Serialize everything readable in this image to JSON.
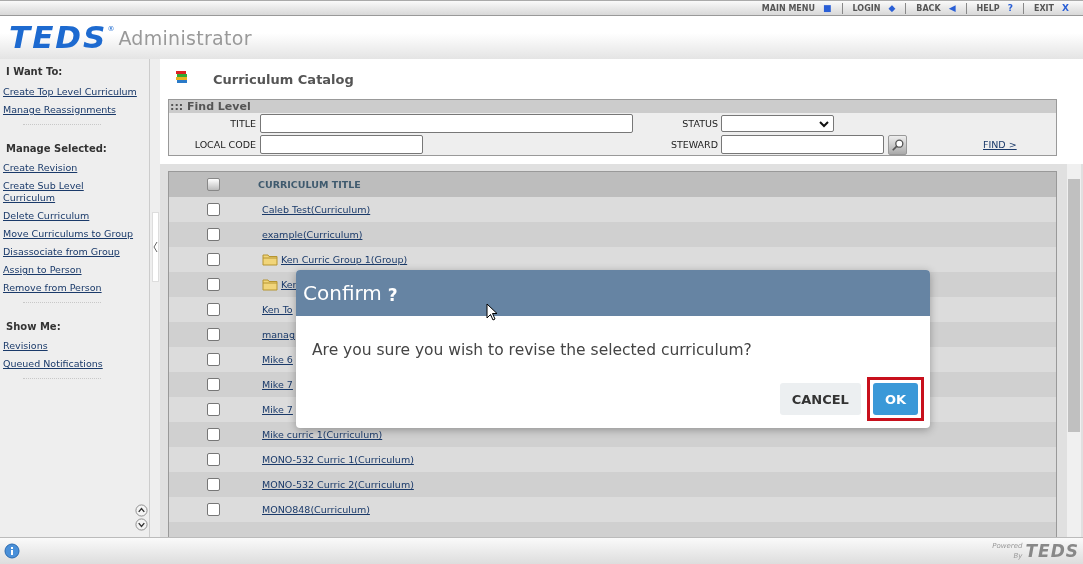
{
  "top_nav": [
    {
      "label": "MAIN MENU",
      "icon": "■"
    },
    {
      "label": "LOGIN",
      "icon": "◆"
    },
    {
      "label": "BACK",
      "icon": "◀"
    },
    {
      "label": "HELP",
      "icon": "?"
    },
    {
      "label": "EXIT",
      "icon": "X"
    }
  ],
  "header": {
    "logo": "TEDS",
    "logo_mark": "®",
    "title": "Administrator"
  },
  "sidebar": {
    "sections": [
      {
        "heading": "I Want To:",
        "links": [
          "Create Top Level Curriculum",
          "Manage Reassignments"
        ]
      },
      {
        "heading": "Manage Selected:",
        "links": [
          "Create Revision",
          "Create Sub Level\nCurriculum",
          "Delete Curriculum",
          "Move Curriculums to Group",
          "Disassociate from Group",
          "Assign to Person",
          "Remove from Person"
        ]
      },
      {
        "heading": "Show Me:",
        "links": [
          "Revisions",
          "Queued Notifications"
        ]
      }
    ]
  },
  "page_title": "Curriculum Catalog",
  "find_panel": {
    "title": "::: Find Level",
    "rows": [
      [
        {
          "label": "TITLE",
          "kind": "text"
        },
        {
          "label": "STATUS",
          "kind": "select"
        }
      ],
      [
        {
          "label": "LOCAL CODE",
          "kind": "text"
        },
        {
          "label": "STEWARD",
          "kind": "lookup"
        }
      ]
    ],
    "find_link": "FIND >"
  },
  "table": {
    "header": "CURRICULUM TITLE",
    "header_checked": false,
    "rows": [
      {
        "title": "Caleb Test(Curriculum)",
        "kind": "curriculum",
        "checked": false
      },
      {
        "title": "example(Curriculum)",
        "kind": "curriculum",
        "checked": false
      },
      {
        "title": "Ken Curric Group 1(Group)",
        "kind": "group",
        "checked": false
      },
      {
        "title": "Ken",
        "kind": "group",
        "checked": false
      },
      {
        "title": "Ken To",
        "kind": "curriculum",
        "checked": false
      },
      {
        "title": "manag",
        "kind": "curriculum",
        "checked": false
      },
      {
        "title": "Mike 6",
        "kind": "curriculum",
        "checked": false
      },
      {
        "title": "Mike 7",
        "kind": "curriculum",
        "checked": false
      },
      {
        "title": "Mike 7",
        "kind": "curriculum",
        "checked": false
      },
      {
        "title": "Mike curric 1(Curriculum)",
        "kind": "curriculum",
        "checked": false
      },
      {
        "title": "MONO-532 Curric 1(Curriculum)",
        "kind": "curriculum",
        "checked": false
      },
      {
        "title": "MONO-532 Curric 2(Curriculum)",
        "kind": "curriculum",
        "checked": false
      },
      {
        "title": "MONO848(Curriculum)",
        "kind": "curriculum",
        "checked": false
      }
    ]
  },
  "dialog": {
    "title": "Confirm",
    "title_icon": "?",
    "message": "Are you sure you wish to revise the selected curriculum?",
    "buttons": [
      {
        "label": "CANCEL",
        "kind": "secondary",
        "focused": false
      },
      {
        "label": "OK",
        "kind": "primary",
        "focused": true
      }
    ]
  },
  "footer": {
    "powered": "Powered",
    "by": "By",
    "logo": "TEDS"
  }
}
